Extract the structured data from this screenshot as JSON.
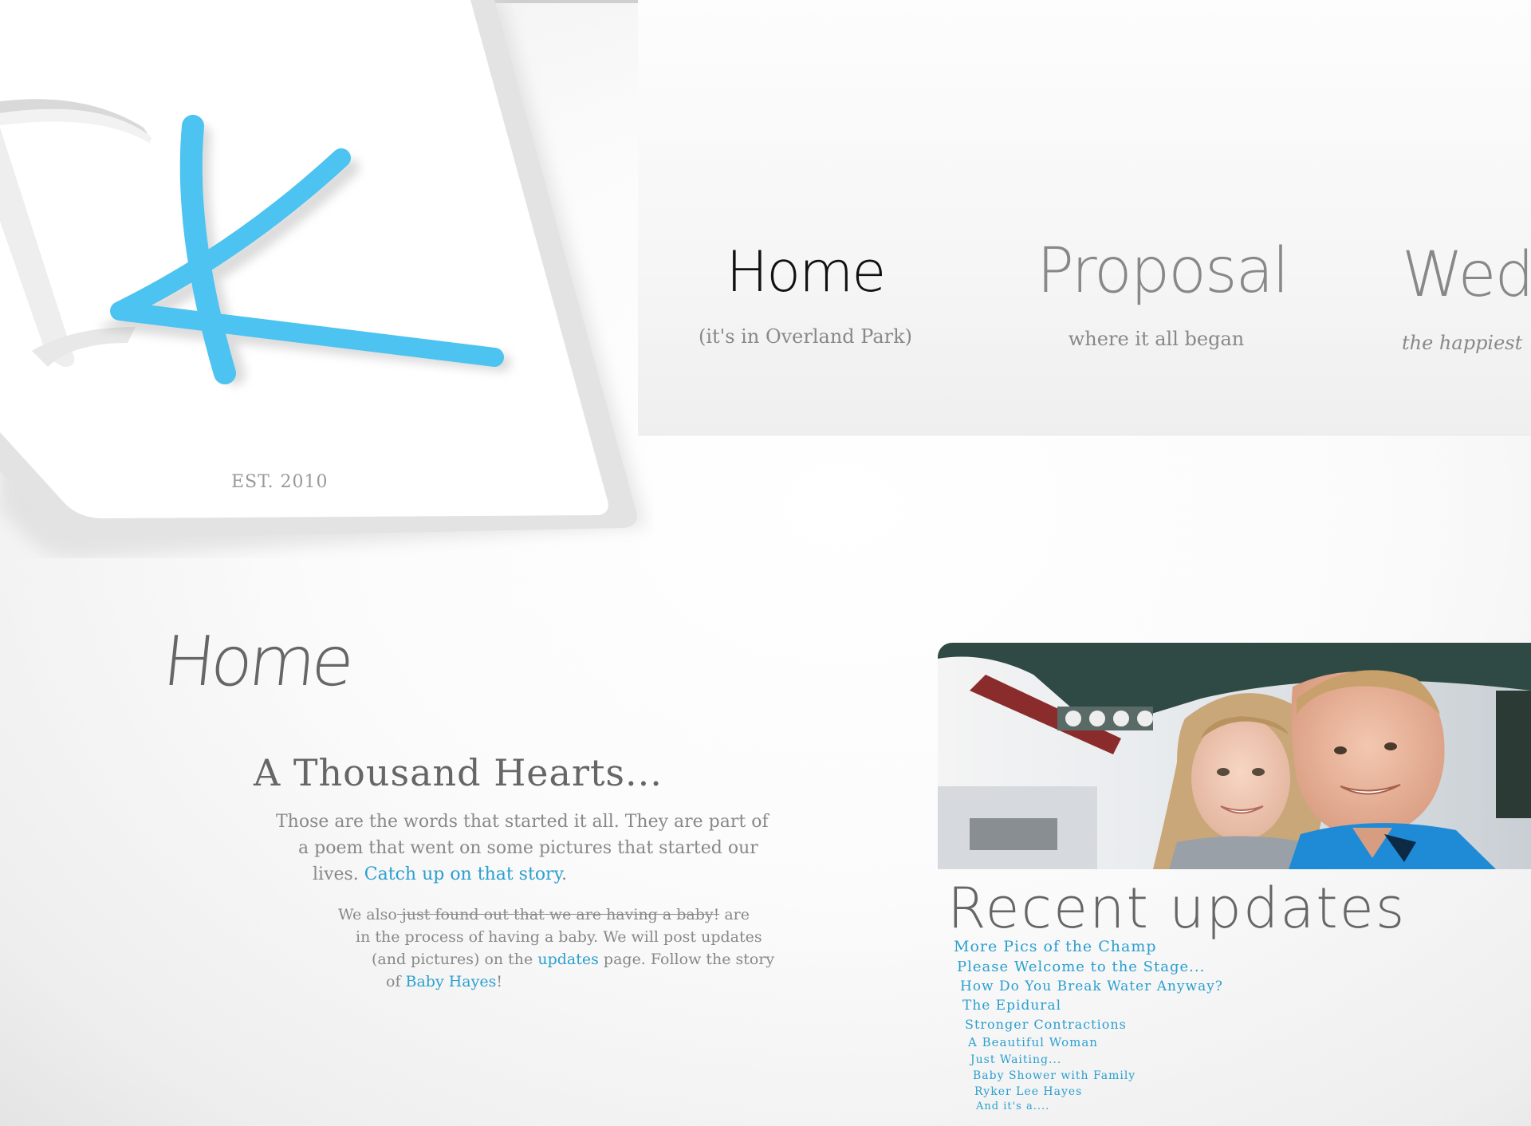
{
  "logo": {
    "est": "EST. 2010",
    "accent": "#4cc3f0"
  },
  "nav": [
    {
      "title": "Home",
      "sub": "(it's in Overland Park)"
    },
    {
      "title": "Proposal",
      "sub": "where it all began"
    },
    {
      "title": "Wedd",
      "sub": "the happiest"
    }
  ],
  "main": {
    "page_title": "Home",
    "headline": "A Thousand Hearts...",
    "para1": {
      "line1": "Those are the words that started it all.  They are part of",
      "line2": "a poem that went on some pictures that started our",
      "line3_text": "lives.  ",
      "link": "Catch up on that story",
      "line3_end": "."
    },
    "para2": {
      "p1": "We also",
      "strike": " just found out that we are having a baby!",
      "p2": " are",
      "l2": "in the process of having a baby.  We will post updates",
      "l3a": "(and pictures) on the ",
      "updates_link": "updates",
      "l3b": " page. Follow the story",
      "l4a": "of ",
      "baby_link": "Baby Hayes",
      "l4b": "!"
    }
  },
  "sidebar": {
    "recent_title": "Recent  updates",
    "updates": [
      "More Pics of the Champ",
      "Please Welcome to the Stage...",
      "How Do You Break Water Anyway?",
      "The Epidural",
      "Stronger Contractions",
      "A Beautiful Woman",
      "Just Waiting...",
      "Baby Shower with Family",
      "Ryker Lee Hayes",
      "And it's a...."
    ]
  },
  "colors": {
    "link": "#2b9fcf",
    "text": "#888888"
  }
}
